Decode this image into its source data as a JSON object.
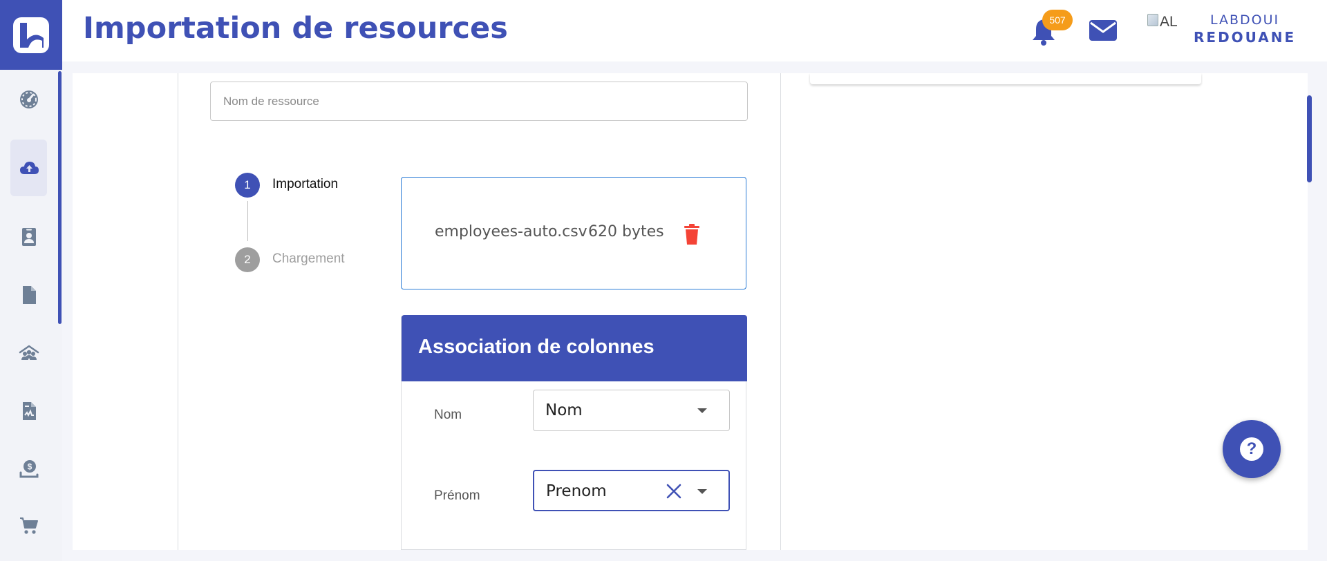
{
  "header": {
    "title": "Importation de resources",
    "notification_count": "507",
    "avatar_alt": "AL",
    "user_first_name": "LABDOUI",
    "user_last_name": "REDOUANE"
  },
  "sidebar": {
    "items": [
      {
        "icon": "dashboard-gauge-icon",
        "active": false
      },
      {
        "icon": "cloud-upload-icon",
        "active": true
      },
      {
        "icon": "contact-card-icon",
        "active": false
      },
      {
        "icon": "document-icon",
        "active": false
      },
      {
        "icon": "team-icon",
        "active": false
      },
      {
        "icon": "receipt-icon",
        "active": false
      },
      {
        "icon": "payment-icon",
        "active": false
      },
      {
        "icon": "cart-icon",
        "active": false
      }
    ]
  },
  "form": {
    "resource_name_placeholder": "Nom de ressource",
    "resource_name_value": ""
  },
  "stepper": {
    "steps": [
      {
        "number": "1",
        "label": "Importation",
        "active": true
      },
      {
        "number": "2",
        "label": "Chargement",
        "active": false
      }
    ]
  },
  "file": {
    "name": "employees-auto.csv",
    "size": "620 bytes"
  },
  "association": {
    "title": "Association de colonnes",
    "rows": [
      {
        "label": "Nom",
        "value": "Nom",
        "clearable": false,
        "focused": false
      },
      {
        "label": "Prénom",
        "value": "Prenom",
        "clearable": true,
        "focused": true
      }
    ]
  },
  "colors": {
    "primary": "#3f51b5",
    "badge": "#f59c1a",
    "delete": "#f44336",
    "file_border": "#2a7bd6"
  }
}
